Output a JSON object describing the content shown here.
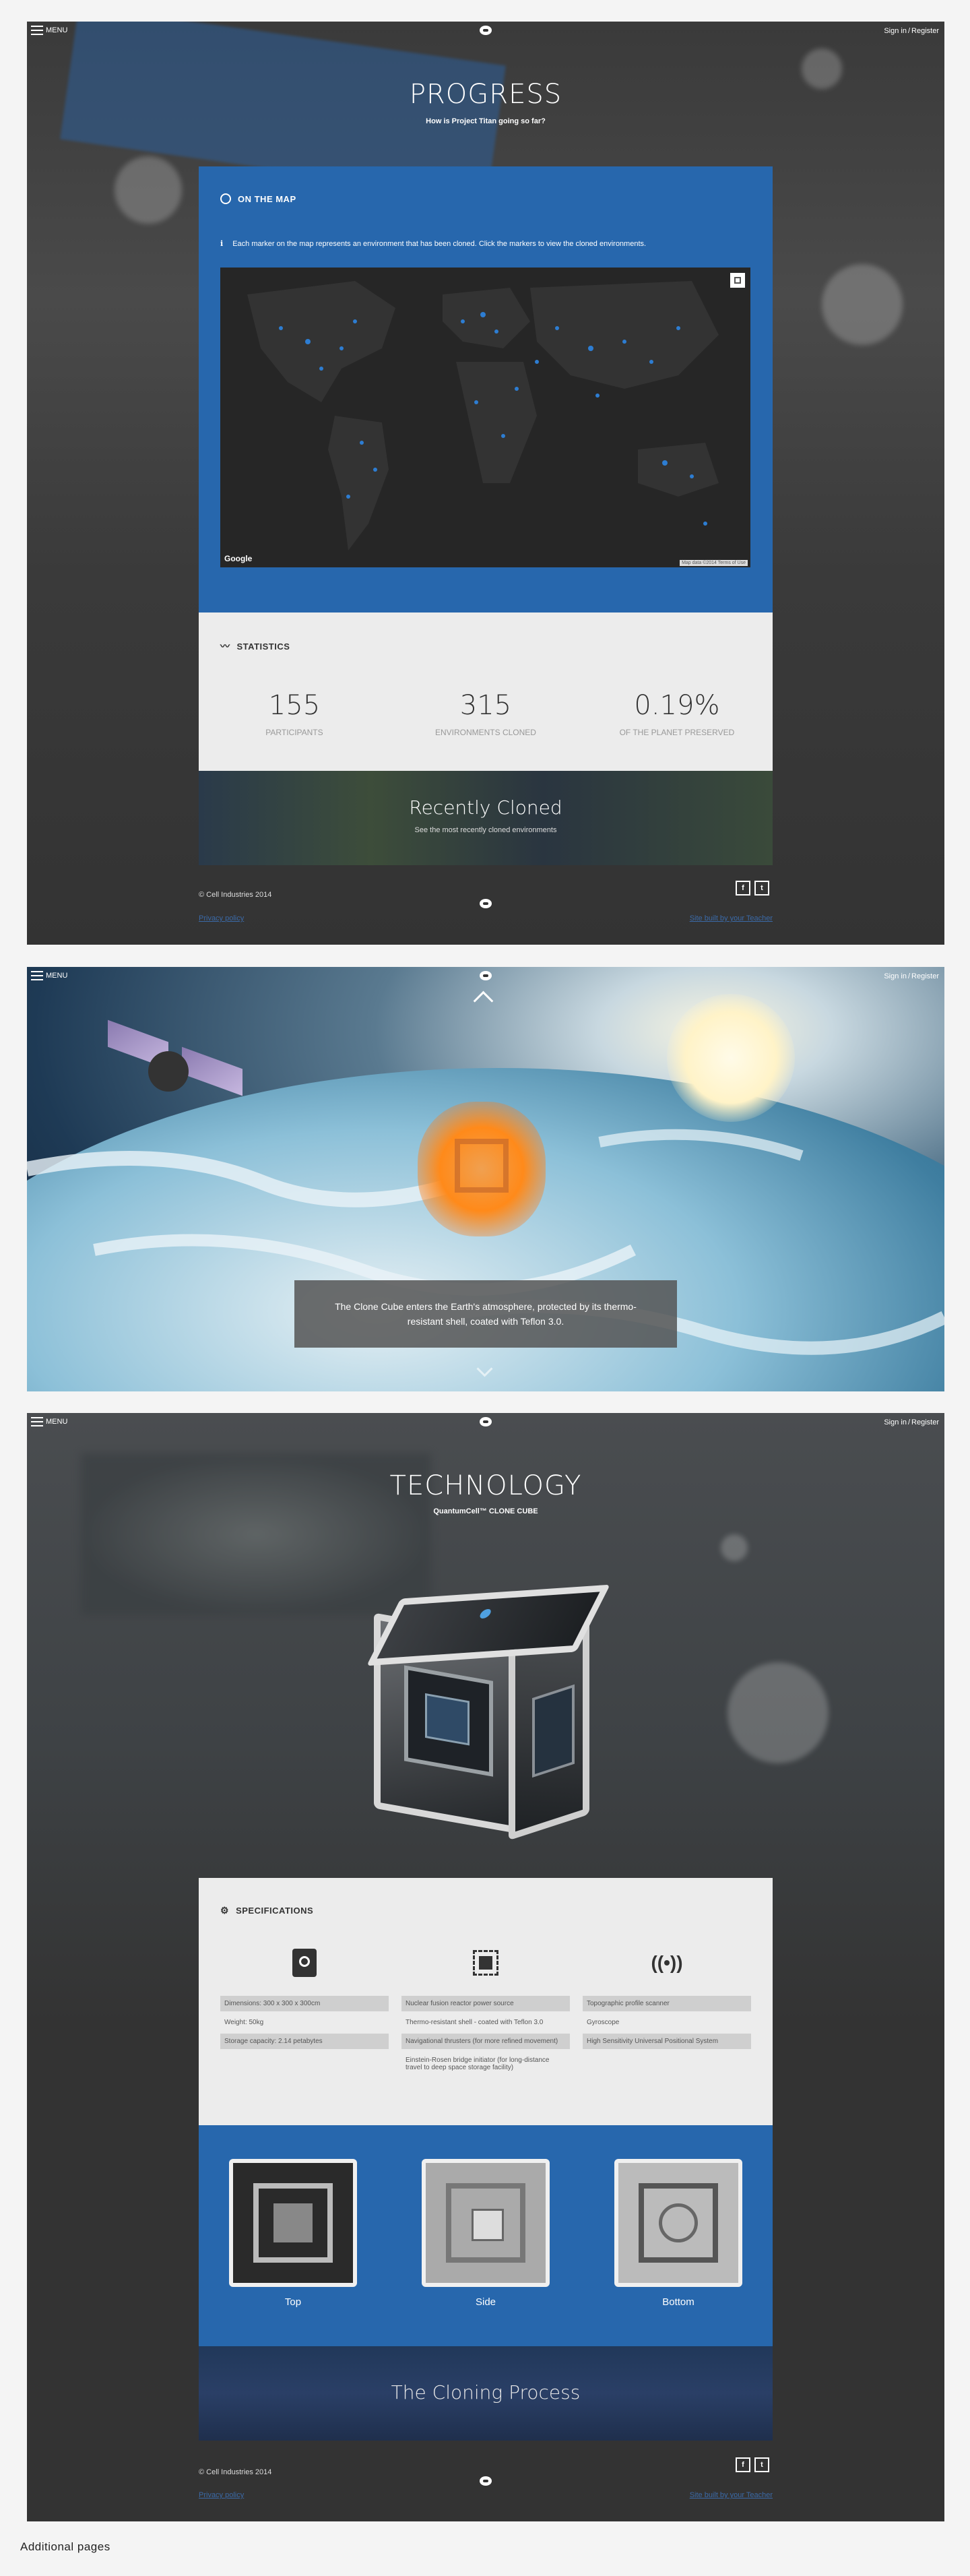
{
  "nav": {
    "menu_label": "MENU",
    "sign_in": "Sign in",
    "separator": "/",
    "register": "Register"
  },
  "progress": {
    "title": "PROGRESS",
    "subtitle": "How is Project Titan going so far?",
    "map": {
      "heading": "ON THE MAP",
      "info": "Each marker on the map represents an environment that has been cloned. Click the markers to view the cloned environments.",
      "google_label": "Google",
      "attribution": "Map data ©2014   Terms of Use"
    },
    "statistics": {
      "heading": "STATISTICS",
      "items": [
        {
          "value": "155",
          "label": "PARTICIPANTS"
        },
        {
          "value": "315",
          "label": "ENVIRONMENTS CLONED"
        },
        {
          "value": "0.19%",
          "label": "OF THE PLANET PRESERVED"
        }
      ]
    },
    "recent": {
      "title": "Recently Cloned",
      "subtitle": "See the most recently cloned environments"
    },
    "footer": {
      "copyright": "© Cell Industries 2014",
      "privacy": "Privacy policy",
      "credit": "Site built by your Teacher"
    }
  },
  "atmosphere": {
    "caption": "The Clone Cube enters the Earth's atmosphere, protected by its thermo-resistant shell, coated with Teflon 3.0."
  },
  "technology": {
    "title": "TECHNOLOGY",
    "subtitle": "QuantumCell™ CLONE CUBE",
    "specs": {
      "heading": "SPECIFICATIONS",
      "columns": [
        {
          "icon": "hard-drive-icon",
          "items": [
            "Dimensions: 300 x 300 x 300cm",
            "Weight: 50kg",
            "Storage capacity: 2.14 petabytes"
          ]
        },
        {
          "icon": "chip-icon",
          "items": [
            "Nuclear fusion reactor power source",
            "Thermo-resistant shell - coated with Teflon 3.0",
            "Navigational thrusters (for more refined movement)",
            "Einstein-Rosen bridge initiator (for long-distance travel to deep space storage facility)"
          ]
        },
        {
          "icon": "signal-icon",
          "items": [
            "Topographic profile scanner",
            "Gyroscope",
            "High Sensitivity Universal Positional System"
          ]
        }
      ]
    },
    "views": [
      "Top",
      "Side",
      "Bottom"
    ],
    "cloning": "The Cloning Process",
    "footer": {
      "copyright": "© Cell Industries 2014",
      "privacy": "Privacy policy",
      "credit": "Site built by your Teacher"
    }
  },
  "page_footer": "Additional pages",
  "social": {
    "facebook": "f",
    "twitter": "t"
  },
  "colors": {
    "brand_blue": "#2767ad",
    "panel_dark": "#333333",
    "stats_bg": "#ececec"
  }
}
